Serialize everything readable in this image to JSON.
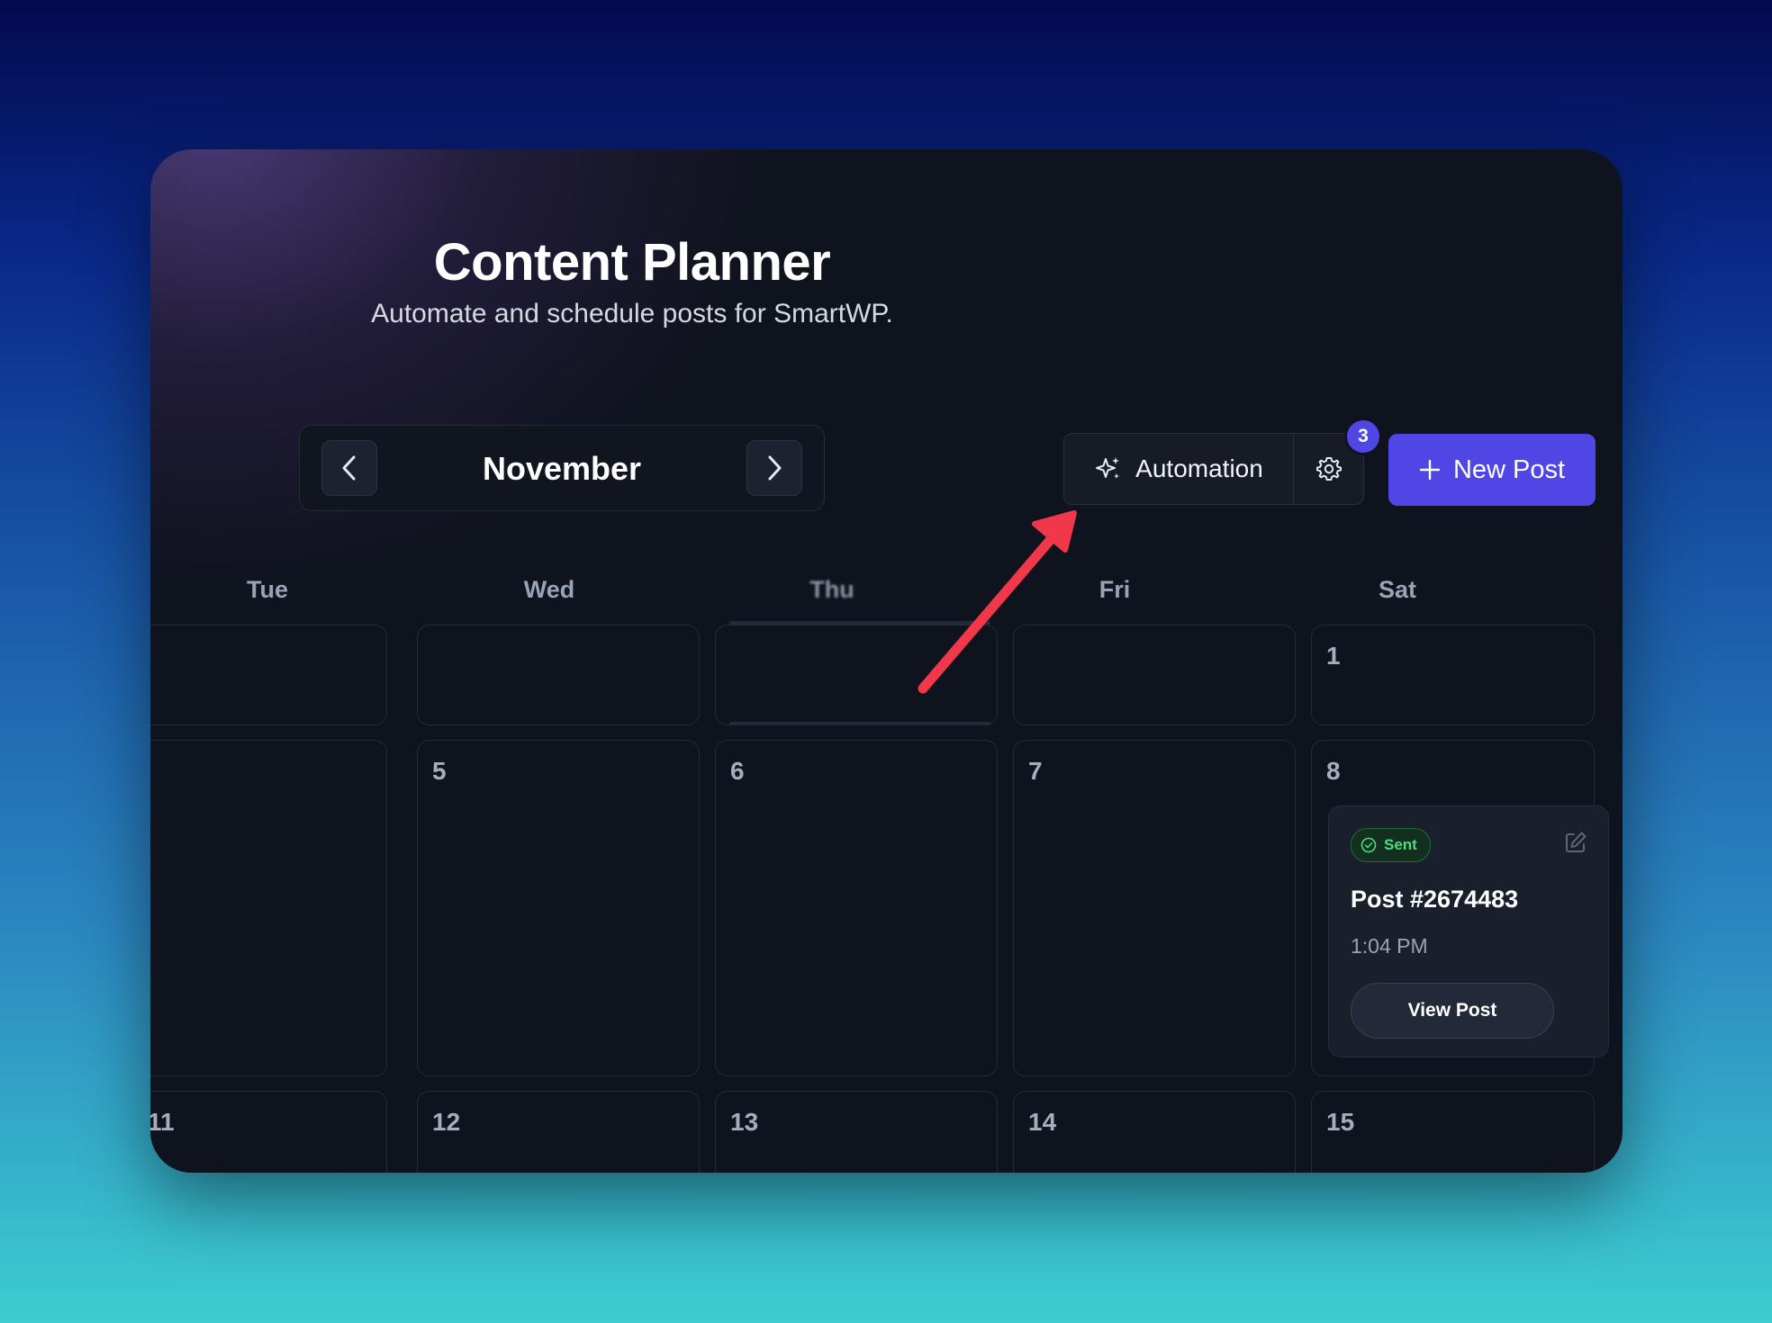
{
  "header": {
    "title": "Content Planner",
    "subtitle": "Automate and schedule posts for SmartWP."
  },
  "calendar_nav": {
    "month": "November",
    "prev_icon": "chevron-left-icon",
    "next_icon": "chevron-right-icon"
  },
  "toolbar": {
    "automation_label": "Automation",
    "automation_icon": "sparkles-icon",
    "settings_icon": "gear-icon",
    "settings_badge": "3",
    "new_post_label": "New Post",
    "new_post_icon": "plus-icon"
  },
  "weekdays": [
    "Tue",
    "Wed",
    "Thu",
    "Fri",
    "Sat"
  ],
  "weeks": [
    [
      "",
      "",
      "",
      "",
      "1"
    ],
    [
      "",
      "5",
      "6",
      "7",
      "8"
    ],
    [
      "11",
      "12",
      "13",
      "14",
      "15"
    ]
  ],
  "post": {
    "status": "Sent",
    "title": "Post #2674483",
    "time": "1:04 PM",
    "view_label": "View Post"
  },
  "colors": {
    "accent": "#4f46e5",
    "card_bg": "#0f131d",
    "sent_green": "#4ade80",
    "annotation_arrow": "#f0384a"
  }
}
